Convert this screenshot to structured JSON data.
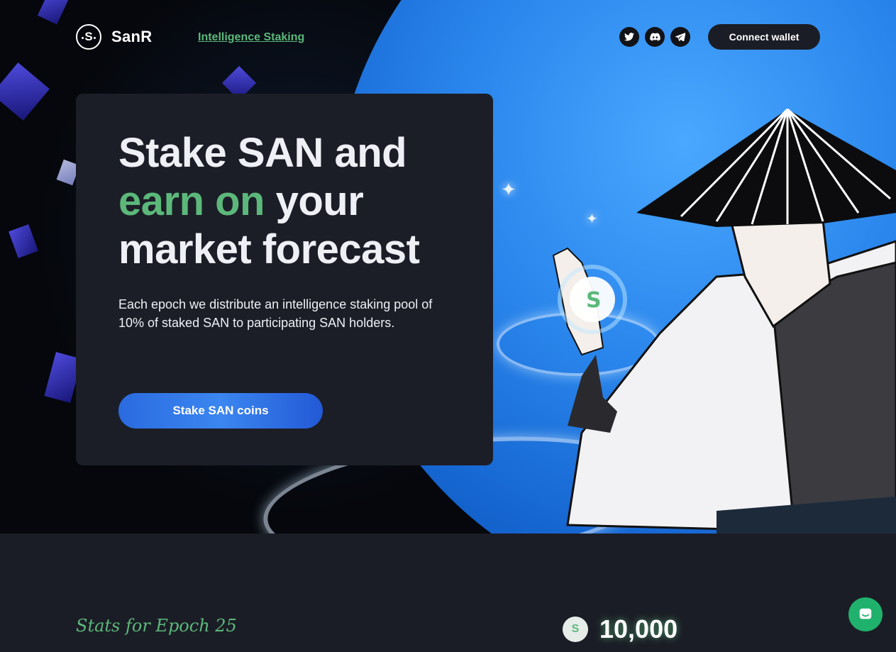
{
  "brand": {
    "name": "SanR",
    "logo_glyph": "S"
  },
  "nav": {
    "link_label": "Intelligence Staking"
  },
  "socials": [
    {
      "icon": "twitter-icon"
    },
    {
      "icon": "discord-icon"
    },
    {
      "icon": "telegram-icon"
    }
  ],
  "header": {
    "connect_label": "Connect wallet"
  },
  "hero": {
    "line1": "Stake SAN and",
    "line2_green": "earn on",
    "line2_rest": " your",
    "line3": "market forecast",
    "description": "Each epoch we distribute an intelligence staking pool of 10% of staked SAN to participating SAN holders.",
    "cta_label": "Stake SAN coins"
  },
  "stats": {
    "epoch_title": "Stats for Epoch 25",
    "value": "10,000",
    "icon_glyph": "S"
  },
  "colors": {
    "accent": "#5cb87a",
    "card": "#1c1e27",
    "page": "#1b1d26",
    "cta": "#2a6be0"
  }
}
